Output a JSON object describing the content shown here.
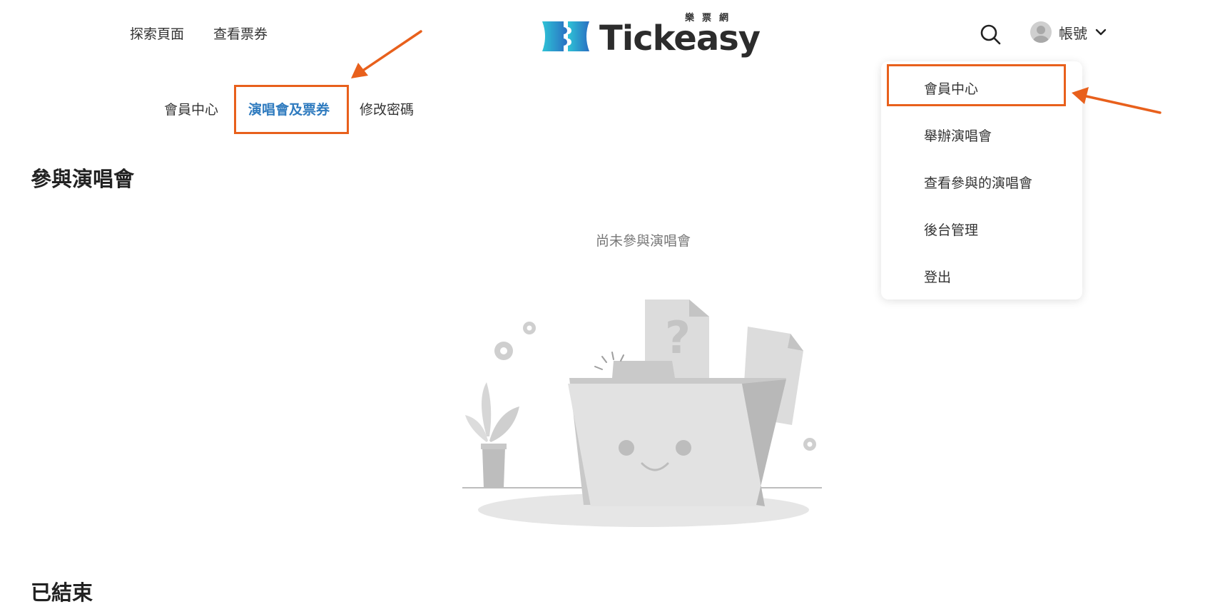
{
  "header": {
    "nav": [
      {
        "label": "探索頁面"
      },
      {
        "label": "查看票券"
      }
    ],
    "logo": {
      "text": "Tickeasy",
      "subtitle": "樂票網"
    },
    "search_icon": "search-icon",
    "account_label": "帳號"
  },
  "subnav": {
    "items": [
      {
        "label": "會員中心"
      },
      {
        "label": "演唱會及票券",
        "active": true
      },
      {
        "label": "修改密碼"
      }
    ]
  },
  "sections": {
    "participating_title": "參與演唱會",
    "empty_message": "尚未參與演唱會",
    "ended_title": "已結束"
  },
  "dropdown": {
    "items": [
      {
        "label": "會員中心"
      },
      {
        "label": "舉辦演唱會"
      },
      {
        "label": "查看參與的演唱會"
      },
      {
        "label": "後台管理"
      },
      {
        "label": "登出"
      }
    ]
  },
  "colors": {
    "accent": "#2f7bbf",
    "annotation": "#e8601c",
    "logo_gradient_start": "#2aa8d8",
    "logo_gradient_end": "#2a6fc2"
  }
}
